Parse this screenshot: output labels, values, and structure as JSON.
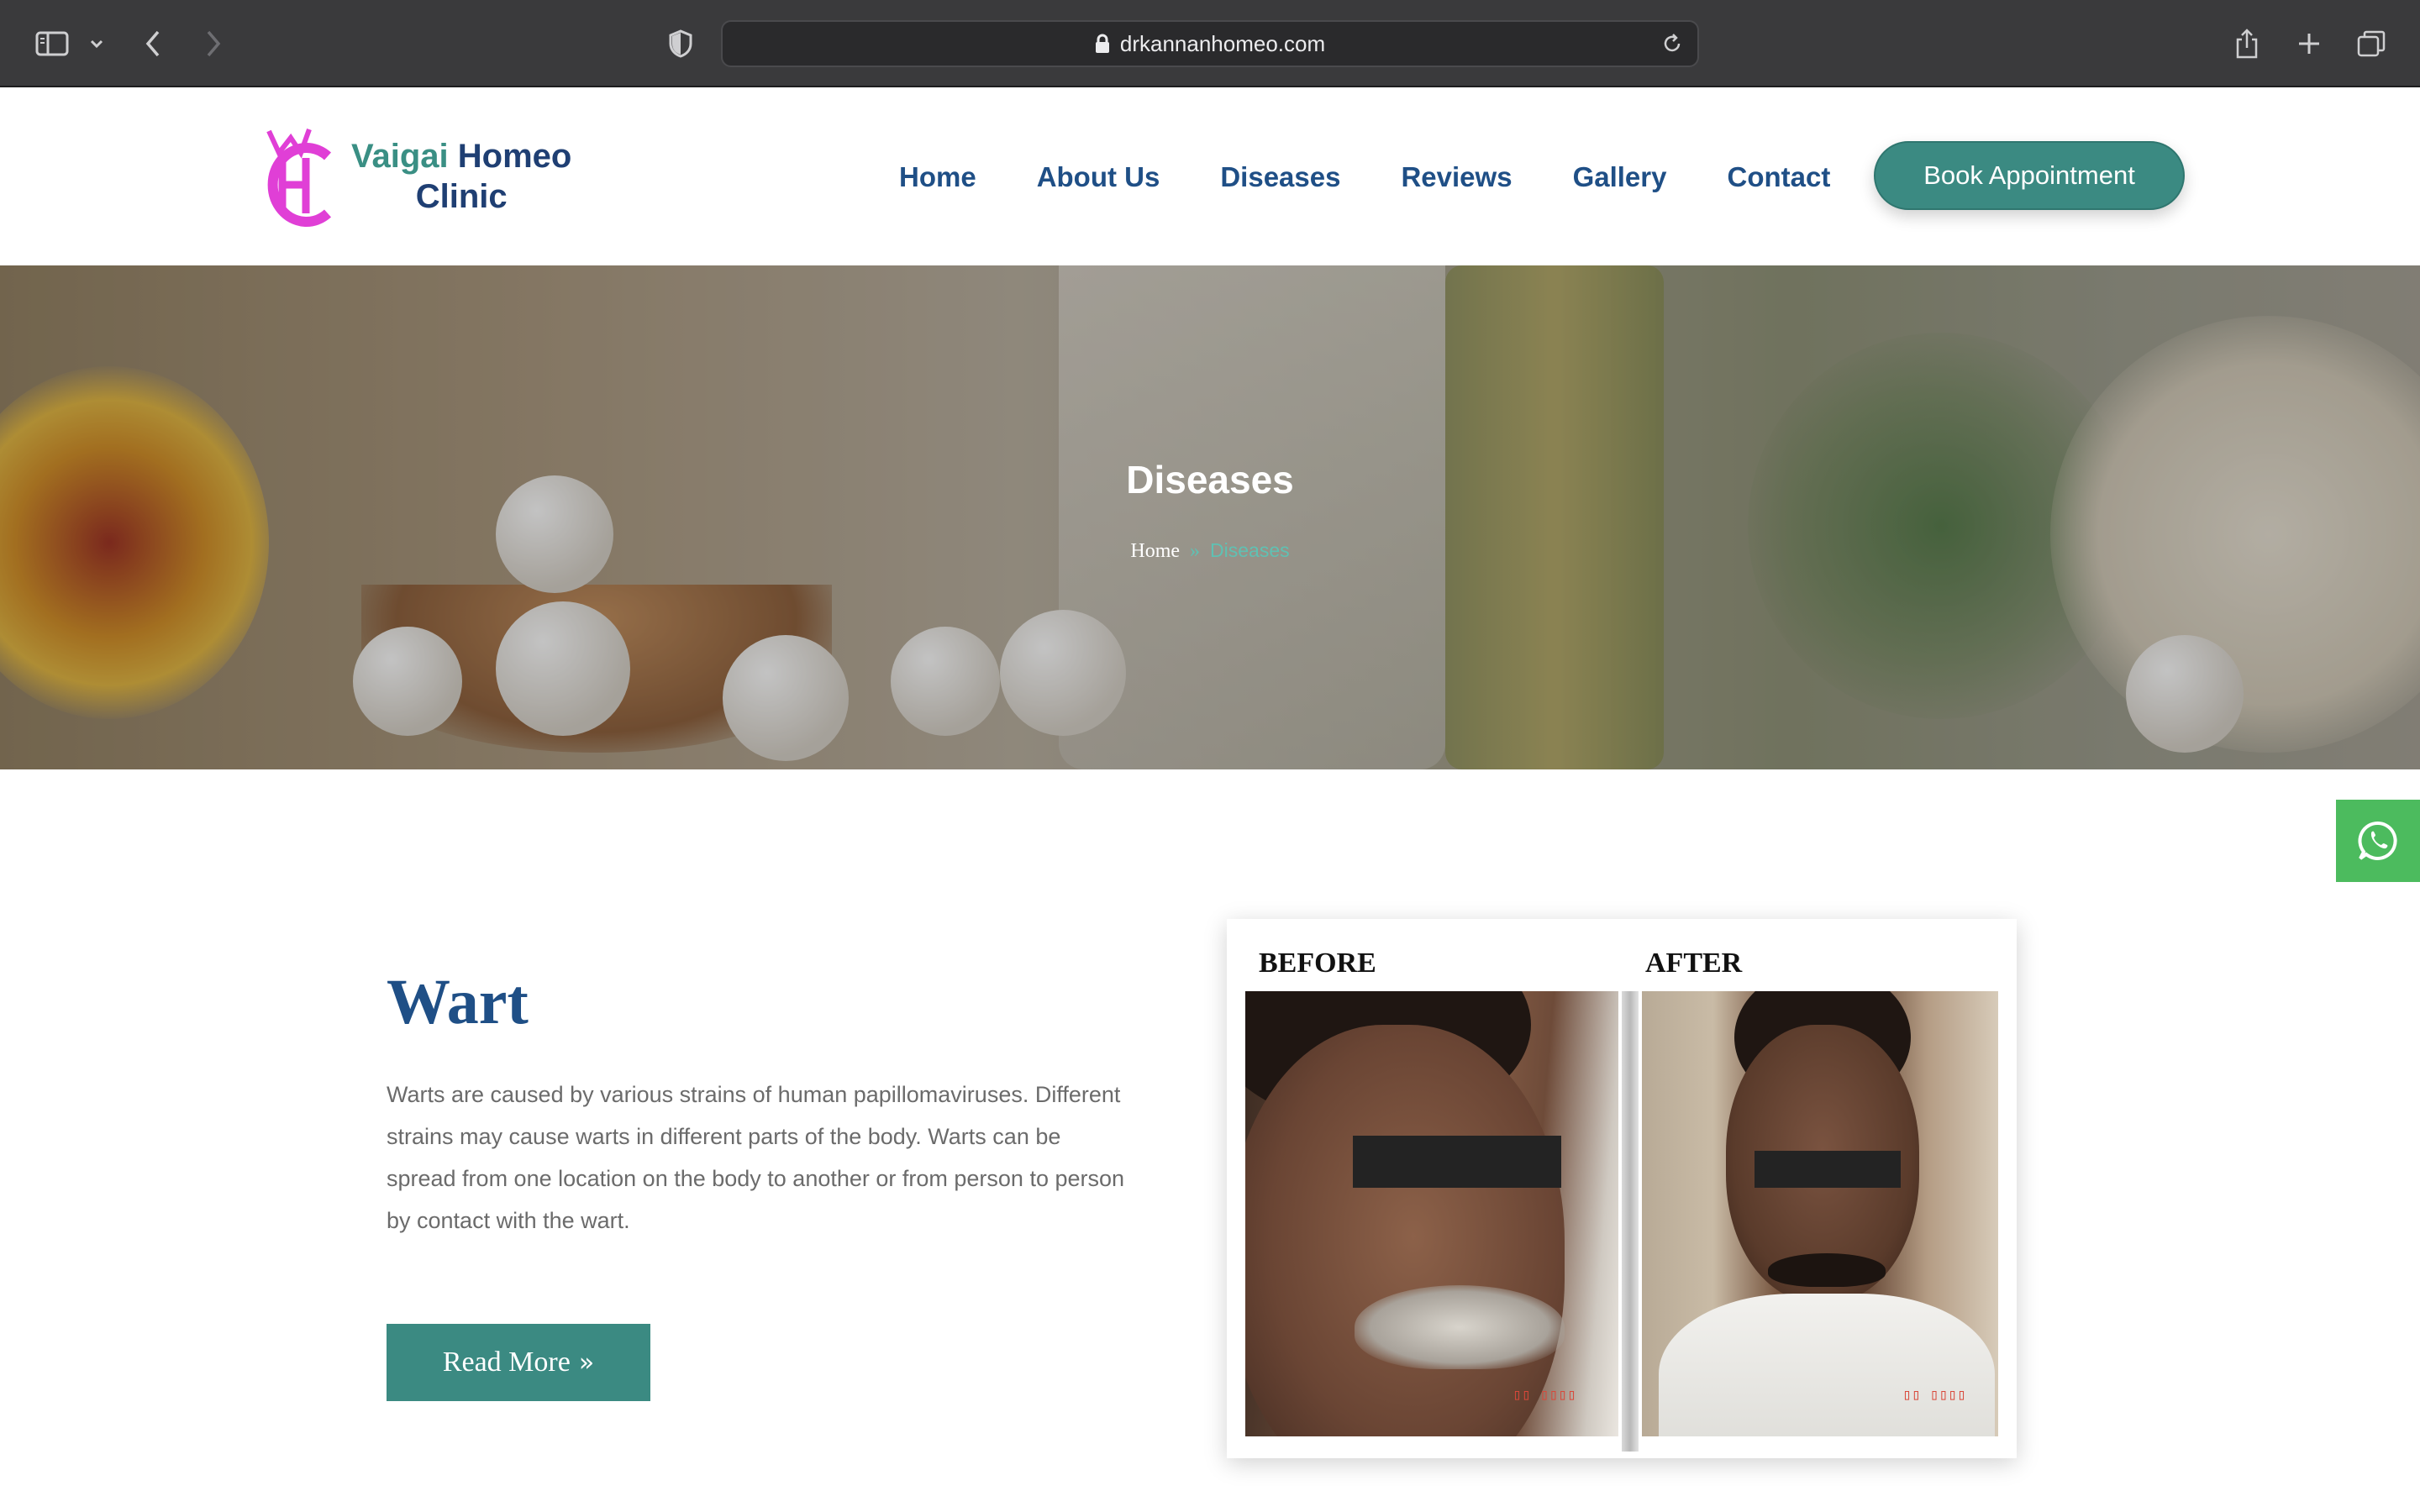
{
  "browser": {
    "url": "drkannanhomeo.com"
  },
  "header": {
    "logo": {
      "line1_a": "Vaigai",
      "line1_b": "Homeo",
      "line2": "Clinic"
    },
    "nav": [
      "Home",
      "About Us",
      "Diseases",
      "Reviews",
      "Gallery",
      "Contact"
    ],
    "cta_label": "Book Appointment"
  },
  "hero": {
    "title": "Diseases",
    "breadcrumb": {
      "home": "Home",
      "separator": "»",
      "current": "Diseases"
    }
  },
  "disease": {
    "title": "Wart",
    "description": "Warts are caused by various strains of human papillomaviruses. Different strains may cause warts in different parts of the body. Warts can be spread from one location on the body to another or from person to person by contact with the wart.",
    "read_more_label": "Read More",
    "image": {
      "before_label": "BEFORE",
      "after_label": "AFTER"
    }
  },
  "colors": {
    "brand_teal": "#3b8a82",
    "nav_blue": "#1f4f86",
    "logo_magenta": "#e03fd6",
    "breadcrumb_accent": "#5fc1b3",
    "whatsapp_green": "#4cbb5e"
  },
  "icons": {
    "sidebar": "sidebar-icon",
    "back": "chevron-left-icon",
    "forward": "chevron-right-icon",
    "privacy": "shield-icon",
    "lock": "lock-icon",
    "reload": "reload-icon",
    "share": "share-icon",
    "new_tab": "plus-icon",
    "tabs": "tabs-icon",
    "whatsapp": "whatsapp-icon",
    "read_more": "double-chevron-right-icon"
  }
}
